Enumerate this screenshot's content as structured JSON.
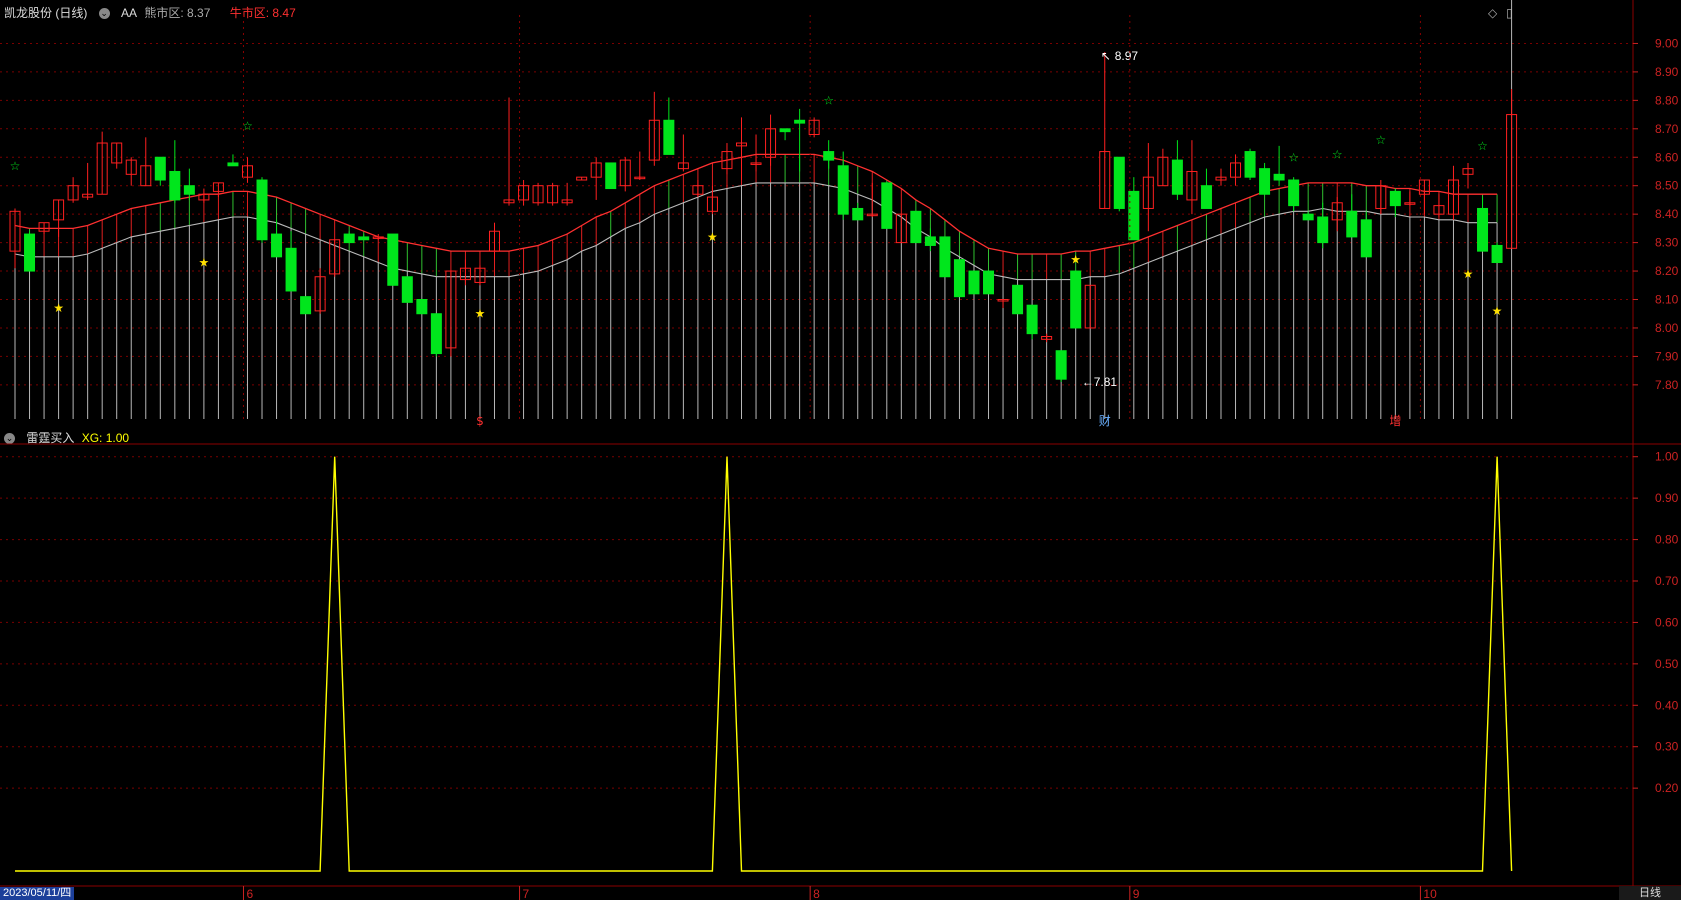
{
  "header": {
    "title": "凯龙股份 (日线)",
    "indicator_name": "AA",
    "bear_label": "熊市区: 8.37",
    "bull_label": "牛市区: 8.47"
  },
  "subheader": {
    "indicator_name": "雷霆买入",
    "xg_label": "XG: 1.00"
  },
  "footer": {
    "start_date": "2023/05/11/四",
    "period": "日线"
  },
  "colors": {
    "up": "#ff2020",
    "down": "#00e61c",
    "bull_band": "#ff3030",
    "bear_band": "#bbbbbb",
    "signal": "#ffff00",
    "grid": "#7a0000",
    "axis_text": "#cc2222"
  },
  "chart_data": [
    {
      "type": "candlestick",
      "ylim": [
        7.68,
        9.1
      ],
      "yticks": [
        "9.00",
        "8.90",
        "8.80",
        "8.70",
        "8.60",
        "8.50",
        "8.40",
        "8.30",
        "8.20",
        "8.10",
        "8.00",
        "7.90",
        "7.80"
      ],
      "month_labels": [
        "6",
        "7",
        "8",
        "9",
        "10"
      ],
      "month_start_index": [
        16,
        35,
        55,
        77,
        97
      ],
      "annotations": {
        "high": "8.97",
        "low": "7.81",
        "high_index": 75,
        "low_index": 73
      },
      "event_markers": [
        {
          "index": 32,
          "label": "$"
        },
        {
          "index": 75,
          "label": "财"
        },
        {
          "index": 95,
          "label": "增"
        }
      ],
      "ohlc": [
        [
          8.27,
          8.42,
          8.21,
          8.41
        ],
        [
          8.33,
          8.34,
          8.2,
          8.2
        ],
        [
          8.34,
          8.37,
          8.33,
          8.37
        ],
        [
          8.38,
          8.45,
          8.32,
          8.45
        ],
        [
          8.45,
          8.53,
          8.44,
          8.5
        ],
        [
          8.46,
          8.58,
          8.45,
          8.47
        ],
        [
          8.47,
          8.69,
          8.47,
          8.65
        ],
        [
          8.58,
          8.65,
          8.56,
          8.65
        ],
        [
          8.54,
          8.6,
          8.5,
          8.59
        ],
        [
          8.5,
          8.67,
          8.5,
          8.57
        ],
        [
          8.6,
          8.6,
          8.5,
          8.52
        ],
        [
          8.55,
          8.66,
          8.44,
          8.45
        ],
        [
          8.5,
          8.56,
          8.45,
          8.47
        ],
        [
          8.45,
          8.49,
          8.44,
          8.47
        ],
        [
          8.48,
          8.51,
          8.46,
          8.51
        ],
        [
          8.58,
          8.61,
          8.57,
          8.57
        ],
        [
          8.53,
          8.6,
          8.51,
          8.57
        ],
        [
          8.52,
          8.53,
          8.3,
          8.31
        ],
        [
          8.33,
          8.38,
          8.25,
          8.25
        ],
        [
          8.28,
          8.34,
          8.13,
          8.13
        ],
        [
          8.11,
          8.11,
          8.05,
          8.05
        ],
        [
          8.06,
          8.21,
          8.05,
          8.18
        ],
        [
          8.19,
          8.31,
          8.18,
          8.31
        ],
        [
          8.33,
          8.34,
          8.3,
          8.3
        ],
        [
          8.32,
          8.33,
          8.31,
          8.31
        ],
        [
          8.32,
          8.33,
          8.31,
          8.32
        ],
        [
          8.33,
          8.33,
          8.15,
          8.15
        ],
        [
          8.18,
          8.18,
          8.09,
          8.09
        ],
        [
          8.1,
          8.1,
          8.05,
          8.05
        ],
        [
          8.05,
          8.05,
          7.9,
          7.91
        ],
        [
          7.93,
          8.2,
          7.9,
          8.2
        ],
        [
          8.17,
          8.24,
          8.15,
          8.21
        ],
        [
          8.16,
          8.22,
          8.15,
          8.21
        ],
        [
          8.27,
          8.37,
          8.24,
          8.34
        ],
        [
          8.44,
          8.81,
          8.43,
          8.45
        ],
        [
          8.45,
          8.52,
          8.43,
          8.5
        ],
        [
          8.44,
          8.51,
          8.43,
          8.5
        ],
        [
          8.44,
          8.51,
          8.43,
          8.5
        ],
        [
          8.44,
          8.51,
          8.43,
          8.45
        ],
        [
          8.52,
          8.53,
          8.52,
          8.53
        ],
        [
          8.53,
          8.6,
          8.45,
          8.58
        ],
        [
          8.58,
          8.58,
          8.49,
          8.49
        ],
        [
          8.5,
          8.6,
          8.48,
          8.59
        ],
        [
          8.53,
          8.62,
          8.52,
          8.53
        ],
        [
          8.59,
          8.83,
          8.57,
          8.73
        ],
        [
          8.73,
          8.81,
          8.62,
          8.61
        ],
        [
          8.56,
          8.68,
          8.55,
          8.58
        ],
        [
          8.47,
          8.52,
          8.46,
          8.5
        ],
        [
          8.41,
          8.5,
          8.4,
          8.46
        ],
        [
          8.56,
          8.65,
          8.54,
          8.62
        ],
        [
          8.64,
          8.74,
          8.52,
          8.65
        ],
        [
          8.58,
          8.68,
          8.55,
          8.58
        ],
        [
          8.6,
          8.75,
          8.57,
          8.7
        ],
        [
          8.7,
          8.7,
          8.66,
          8.69
        ],
        [
          8.73,
          8.77,
          8.55,
          8.72
        ],
        [
          8.68,
          8.74,
          8.67,
          8.73
        ],
        [
          8.62,
          8.66,
          8.56,
          8.59
        ],
        [
          8.57,
          8.62,
          8.38,
          8.4
        ],
        [
          8.42,
          8.44,
          8.38,
          8.38
        ],
        [
          8.4,
          8.51,
          8.39,
          8.4
        ],
        [
          8.51,
          8.51,
          8.35,
          8.35
        ],
        [
          8.3,
          8.4,
          8.3,
          8.4
        ],
        [
          8.41,
          8.41,
          8.3,
          8.3
        ],
        [
          8.32,
          8.35,
          8.27,
          8.29
        ],
        [
          8.32,
          8.32,
          8.18,
          8.18
        ],
        [
          8.24,
          8.24,
          8.11,
          8.11
        ],
        [
          8.2,
          8.2,
          8.12,
          8.12
        ],
        [
          8.2,
          8.2,
          8.12,
          8.12
        ],
        [
          8.1,
          8.1,
          8.07,
          8.1
        ],
        [
          8.15,
          8.15,
          8.05,
          8.05
        ],
        [
          8.08,
          8.08,
          7.96,
          7.98
        ],
        [
          7.96,
          7.98,
          7.95,
          7.97
        ],
        [
          7.92,
          7.92,
          7.81,
          7.82
        ],
        [
          8.2,
          8.2,
          8.0,
          8.0
        ],
        [
          8.0,
          8.15,
          8.0,
          8.15
        ],
        [
          8.42,
          8.97,
          8.42,
          8.62
        ],
        [
          8.6,
          8.6,
          8.41,
          8.42
        ],
        [
          8.48,
          8.53,
          8.31,
          8.31
        ],
        [
          8.42,
          8.65,
          8.34,
          8.53
        ],
        [
          8.5,
          8.63,
          8.5,
          8.6
        ],
        [
          8.59,
          8.66,
          8.45,
          8.47
        ],
        [
          8.45,
          8.66,
          8.4,
          8.55
        ],
        [
          8.5,
          8.56,
          8.42,
          8.42
        ],
        [
          8.52,
          8.56,
          8.5,
          8.53
        ],
        [
          8.53,
          8.61,
          8.5,
          8.58
        ],
        [
          8.62,
          8.63,
          8.52,
          8.53
        ],
        [
          8.56,
          8.58,
          8.47,
          8.47
        ],
        [
          8.54,
          8.64,
          8.5,
          8.52
        ],
        [
          8.52,
          8.53,
          8.41,
          8.43
        ],
        [
          8.4,
          8.41,
          8.38,
          8.38
        ],
        [
          8.39,
          8.44,
          8.28,
          8.3
        ],
        [
          8.38,
          8.46,
          8.34,
          8.44
        ],
        [
          8.41,
          8.47,
          8.32,
          8.32
        ],
        [
          8.38,
          8.41,
          8.25,
          8.25
        ],
        [
          8.42,
          8.52,
          8.4,
          8.5
        ],
        [
          8.48,
          8.49,
          8.39,
          8.43
        ],
        [
          8.44,
          8.48,
          8.43,
          8.44
        ],
        [
          8.47,
          8.52,
          8.4,
          8.52
        ],
        [
          8.4,
          8.47,
          8.39,
          8.43
        ],
        [
          8.4,
          8.57,
          8.38,
          8.52
        ],
        [
          8.54,
          8.58,
          8.49,
          8.56
        ],
        [
          8.42,
          8.46,
          8.27,
          8.27
        ],
        [
          8.29,
          8.3,
          8.23,
          8.23
        ],
        [
          8.28,
          8.84,
          8.28,
          8.75
        ]
      ],
      "bull_band": [
        8.36,
        8.35,
        8.35,
        8.35,
        8.35,
        8.36,
        8.38,
        8.4,
        8.42,
        8.43,
        8.44,
        8.45,
        8.46,
        8.47,
        8.47,
        8.48,
        8.48,
        8.47,
        8.46,
        8.44,
        8.42,
        8.4,
        8.38,
        8.36,
        8.34,
        8.32,
        8.31,
        8.3,
        8.29,
        8.28,
        8.27,
        8.27,
        8.27,
        8.27,
        8.27,
        8.28,
        8.29,
        8.31,
        8.33,
        8.36,
        8.39,
        8.41,
        8.44,
        8.47,
        8.5,
        8.52,
        8.54,
        8.56,
        8.58,
        8.59,
        8.6,
        8.61,
        8.61,
        8.61,
        8.61,
        8.61,
        8.6,
        8.59,
        8.57,
        8.55,
        8.52,
        8.49,
        8.45,
        8.42,
        8.38,
        8.34,
        8.31,
        8.28,
        8.27,
        8.26,
        8.26,
        8.26,
        8.26,
        8.27,
        8.27,
        8.28,
        8.29,
        8.3,
        8.32,
        8.34,
        8.36,
        8.38,
        8.4,
        8.42,
        8.44,
        8.46,
        8.48,
        8.49,
        8.5,
        8.51,
        8.51,
        8.51,
        8.51,
        8.5,
        8.5,
        8.49,
        8.49,
        8.48,
        8.48,
        8.47,
        8.47,
        8.47,
        8.47
      ],
      "bear_band": [
        8.26,
        8.25,
        8.25,
        8.25,
        8.25,
        8.26,
        8.28,
        8.3,
        8.32,
        8.33,
        8.34,
        8.35,
        8.36,
        8.37,
        8.38,
        8.39,
        8.39,
        8.38,
        8.37,
        8.35,
        8.33,
        8.31,
        8.29,
        8.27,
        8.25,
        8.23,
        8.21,
        8.2,
        8.19,
        8.18,
        8.18,
        8.18,
        8.18,
        8.18,
        8.18,
        8.19,
        8.2,
        8.22,
        8.24,
        8.27,
        8.29,
        8.32,
        8.35,
        8.37,
        8.4,
        8.42,
        8.44,
        8.46,
        8.48,
        8.49,
        8.5,
        8.51,
        8.51,
        8.51,
        8.51,
        8.51,
        8.5,
        8.49,
        8.47,
        8.45,
        8.42,
        8.39,
        8.35,
        8.32,
        8.28,
        8.25,
        8.22,
        8.19,
        8.18,
        8.17,
        8.17,
        8.17,
        8.17,
        8.17,
        8.18,
        8.18,
        8.19,
        8.21,
        8.23,
        8.25,
        8.27,
        8.29,
        8.31,
        8.33,
        8.35,
        8.37,
        8.39,
        8.4,
        8.41,
        8.41,
        8.42,
        8.41,
        8.41,
        8.41,
        8.4,
        8.4,
        8.39,
        8.39,
        8.38,
        8.38,
        8.37,
        8.37,
        8.37
      ],
      "stars": [
        {
          "index": 0,
          "value": 8.57,
          "color": "green",
          "hollow": true
        },
        {
          "index": 3,
          "value": 8.07,
          "color": "yellow",
          "hollow": false
        },
        {
          "index": 13,
          "value": 8.23,
          "color": "yellow",
          "hollow": false
        },
        {
          "index": 16,
          "value": 8.71,
          "color": "green",
          "hollow": true
        },
        {
          "index": 32,
          "value": 8.05,
          "color": "yellow",
          "hollow": false
        },
        {
          "index": 48,
          "value": 8.32,
          "color": "yellow",
          "hollow": false
        },
        {
          "index": 56,
          "value": 8.8,
          "color": "green",
          "hollow": true
        },
        {
          "index": 73,
          "value": 8.24,
          "color": "yellow",
          "hollow": false
        },
        {
          "index": 88,
          "value": 8.6,
          "color": "green",
          "hollow": true
        },
        {
          "index": 91,
          "value": 8.61,
          "color": "green",
          "hollow": true
        },
        {
          "index": 94,
          "value": 8.66,
          "color": "green",
          "hollow": true
        },
        {
          "index": 100,
          "value": 8.19,
          "color": "yellow",
          "hollow": false
        },
        {
          "index": 101,
          "value": 8.64,
          "color": "green",
          "hollow": true
        },
        {
          "index": 102,
          "value": 8.06,
          "color": "yellow",
          "hollow": false
        }
      ]
    },
    {
      "type": "line",
      "name": "XG",
      "ylim": [
        0,
        1.05
      ],
      "yticks": [
        "1.00",
        "0.90",
        "0.80",
        "0.70",
        "0.60",
        "0.50",
        "0.40",
        "0.30",
        "0.20"
      ],
      "signal_index": [
        22,
        49,
        102
      ]
    }
  ]
}
